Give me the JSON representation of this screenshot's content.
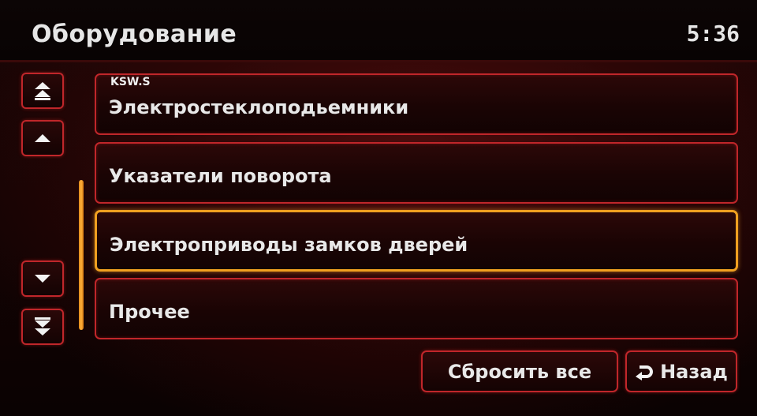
{
  "header": {
    "title": "Оборудование",
    "clock": "5:36"
  },
  "watermark": "KSW.S",
  "scroll": {
    "top_icon": "double-chevron-up-icon",
    "up_icon": "chevron-up-icon",
    "down_icon": "chevron-down-icon",
    "bottom_icon": "double-chevron-down-icon"
  },
  "menu": {
    "items": [
      {
        "label": "Электростеклоподьемники"
      },
      {
        "label": "Указатели поворота"
      },
      {
        "label": "Электроприводы замков дверей"
      },
      {
        "label": "Прочее"
      }
    ],
    "selected_index": 2
  },
  "actions": {
    "reset_label": "Сбросить все",
    "back_label": "Назад",
    "back_icon": "return-arrow-icon"
  },
  "colors": {
    "border": "#c0262a",
    "selected_border": "#f0a020",
    "text": "#e8e8e8",
    "scrollbar": "#f0a020"
  }
}
